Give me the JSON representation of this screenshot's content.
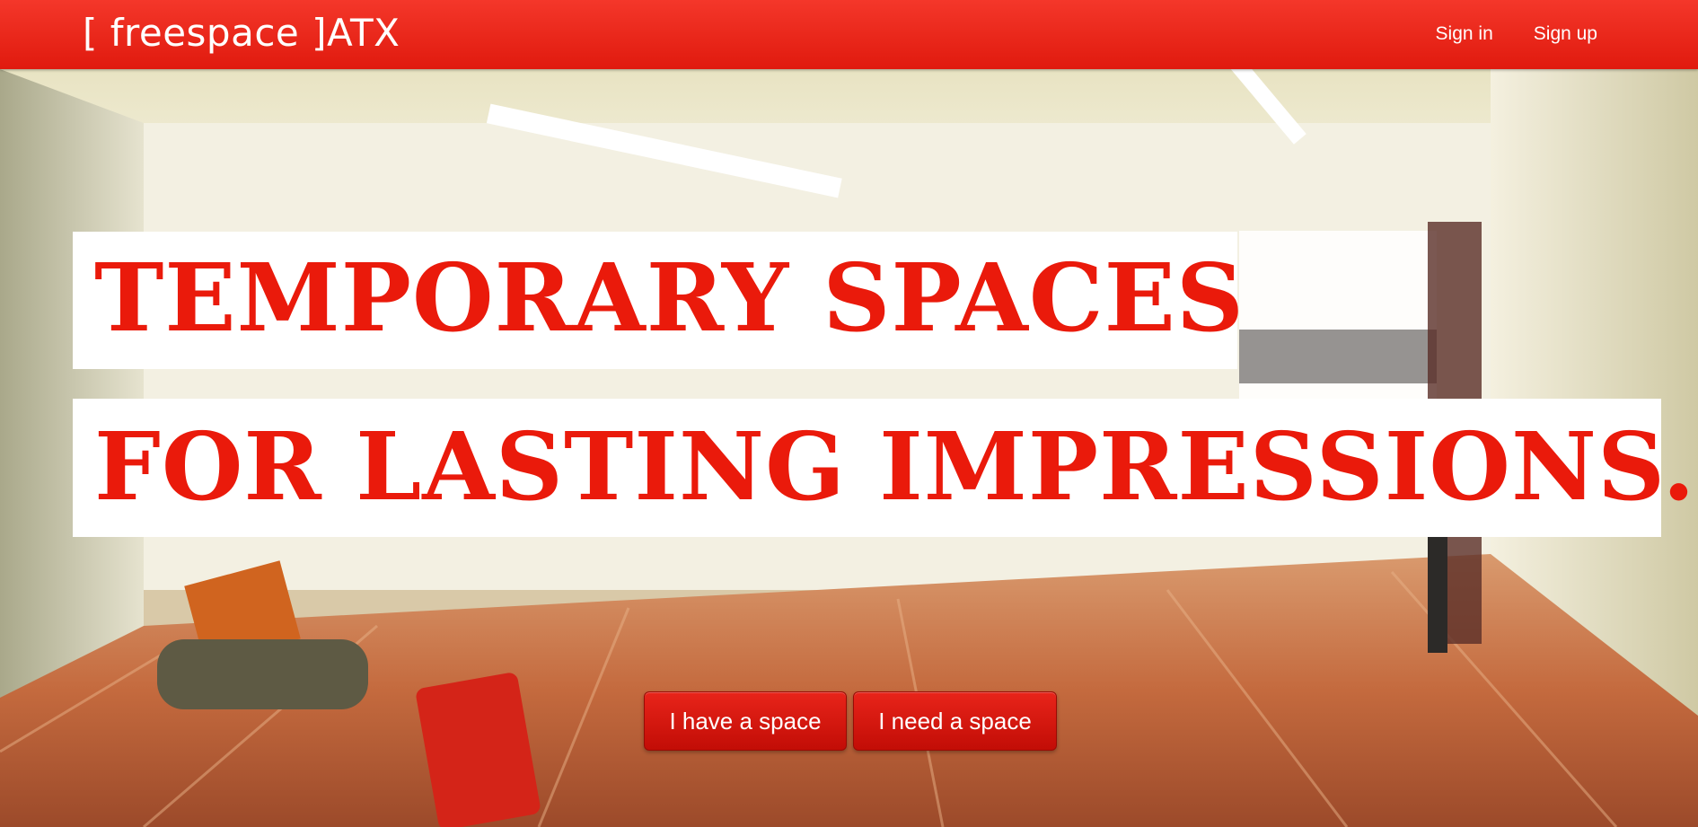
{
  "navbar": {
    "brand": "[ freespace ]ATX",
    "links": [
      "Sign in",
      "Sign up"
    ]
  },
  "hero": {
    "headline_line1": "TEMPORARY SPACES",
    "headline_line2": "FOR LASTING IMPRESSIONS.",
    "buttons": [
      "I have a space",
      "I need a space"
    ],
    "background_description_icon": "loft-interior-photo"
  },
  "colors": {
    "brand_red": "#e8261a",
    "headline_red": "#ea1a0b",
    "headline_bg": "#ffffff",
    "button_red": "#c9110a"
  }
}
